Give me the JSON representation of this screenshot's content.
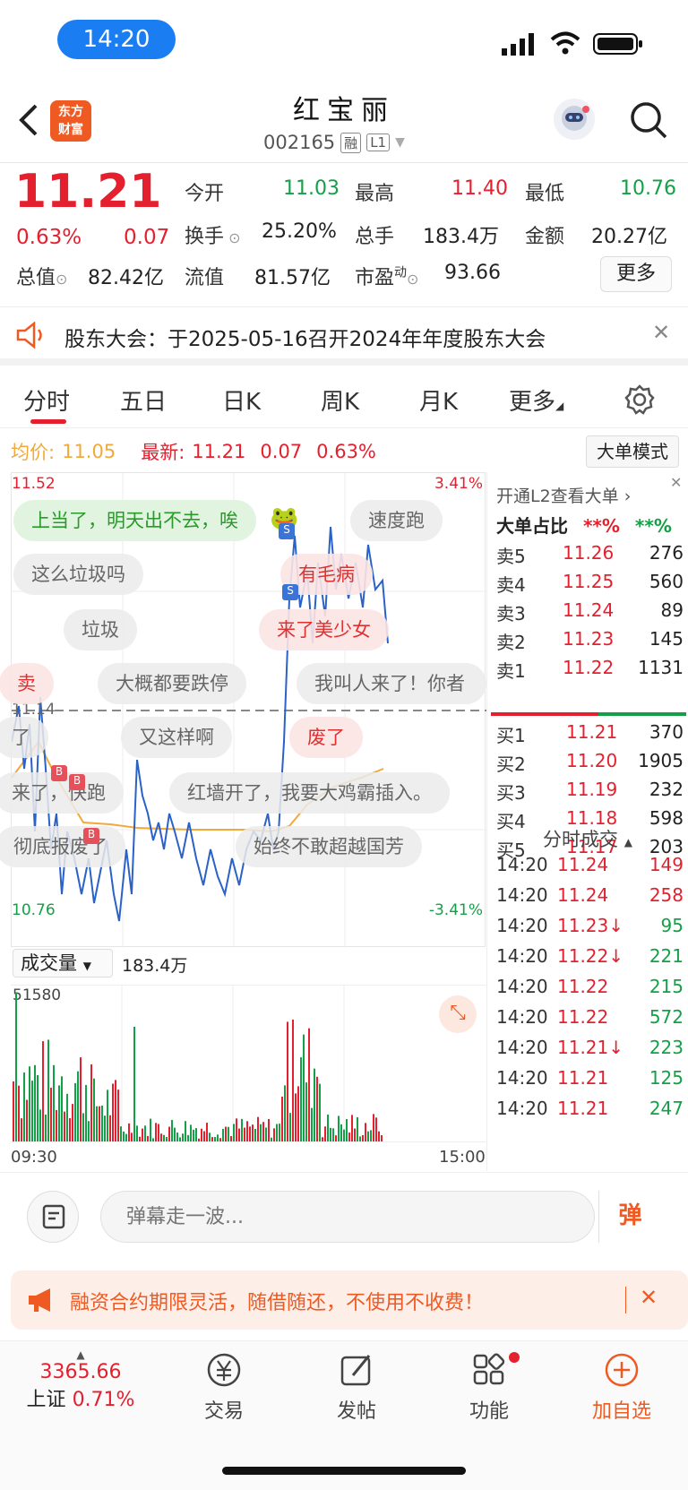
{
  "status": {
    "time": "14:20"
  },
  "header": {
    "title": "红宝丽",
    "code": "002165",
    "badge_rong": "融",
    "badge_l1": "L1",
    "logo_line1": "东方",
    "logo_line2": "财富"
  },
  "quote": {
    "price": "11.21",
    "pct": "0.63%",
    "chg": "0.07",
    "open_label": "今开",
    "open": "11.03",
    "high_label": "最高",
    "high": "11.40",
    "low_label": "最低",
    "low": "10.76",
    "turnover_label": "换手",
    "turnover": "25.20%",
    "volume_label": "总手",
    "volume": "183.4万",
    "amount_label": "金额",
    "amount": "20.27亿",
    "mktcap_label": "总值",
    "mktcap": "82.42亿",
    "float_label": "流值",
    "float": "81.57亿",
    "pe_label": "市盈",
    "pe_sup": "动",
    "pe": "93.66",
    "more": "更多"
  },
  "notice": {
    "text": "股东大会：于2025-05-16召开2024年年度股东大会"
  },
  "tabs": [
    "分时",
    "五日",
    "日K",
    "周K",
    "月K",
    "更多"
  ],
  "chart_info": {
    "avg_label": "均价:",
    "avg": "11.05",
    "latest_label": "最新:",
    "latest": "11.21",
    "chg": "0.07",
    "pct": "0.63%",
    "mode_button": "大单模式",
    "y_top": "11.52",
    "y_bottom": "10.76",
    "pct_top": "3.41%",
    "pct_bottom": "-3.41%",
    "mid_label": "11.14"
  },
  "danmaku": [
    {
      "text": "上当了，明天出不去，唉",
      "style": "green"
    },
    {
      "text": "速度跑",
      "style": "gray"
    },
    {
      "text": "这么垃圾吗",
      "style": "gray"
    },
    {
      "text": "有毛病",
      "style": "pink"
    },
    {
      "text": "垃圾",
      "style": "gray"
    },
    {
      "text": "来了美少女",
      "style": "pink"
    },
    {
      "text": "卖",
      "style": "pink"
    },
    {
      "text": "大概都要跌停",
      "style": "gray"
    },
    {
      "text": "我叫人来了！你者",
      "style": "gray"
    },
    {
      "text": "了",
      "style": "gray"
    },
    {
      "text": "又这样啊",
      "style": "gray"
    },
    {
      "text": "废了",
      "style": "pink"
    },
    {
      "text": "来了，快跑",
      "style": "gray"
    },
    {
      "text": "红墙开了，我要大鸡霸插入。",
      "style": "gray"
    },
    {
      "text": "彻底报废了",
      "style": "gray"
    },
    {
      "text": "始终不敢超越国芳",
      "style": "gray"
    }
  ],
  "orderbook": {
    "l2_text": "开通L2查看大单",
    "big_ratio_label": "大单占比",
    "ratio_sell": "**%",
    "ratio_buy": "**%",
    "asks": [
      {
        "label": "卖5",
        "price": "11.26",
        "vol": "276"
      },
      {
        "label": "卖4",
        "price": "11.25",
        "vol": "560"
      },
      {
        "label": "卖3",
        "price": "11.24",
        "vol": "89"
      },
      {
        "label": "卖2",
        "price": "11.23",
        "vol": "145"
      },
      {
        "label": "卖1",
        "price": "11.22",
        "vol": "1131"
      }
    ],
    "bids": [
      {
        "label": "买1",
        "price": "11.21",
        "vol": "370"
      },
      {
        "label": "买2",
        "price": "11.20",
        "vol": "1905"
      },
      {
        "label": "买3",
        "price": "11.19",
        "vol": "232"
      },
      {
        "label": "买4",
        "price": "11.18",
        "vol": "598"
      },
      {
        "label": "买5",
        "price": "11.17",
        "vol": "203"
      }
    ],
    "trades_title": "分时成交",
    "trades": [
      {
        "t": "14:20",
        "p": "11.24",
        "v": "149",
        "dir": "up"
      },
      {
        "t": "14:20",
        "p": "11.24",
        "v": "258",
        "dir": "up"
      },
      {
        "t": "14:20",
        "p": "11.23↓",
        "v": "95",
        "dir": "down"
      },
      {
        "t": "14:20",
        "p": "11.22↓",
        "v": "221",
        "dir": "down"
      },
      {
        "t": "14:20",
        "p": "11.22",
        "v": "215",
        "dir": "down"
      },
      {
        "t": "14:20",
        "p": "11.22",
        "v": "572",
        "dir": "down"
      },
      {
        "t": "14:20",
        "p": "11.21↓",
        "v": "223",
        "dir": "down"
      },
      {
        "t": "14:20",
        "p": "11.21",
        "v": "125",
        "dir": "down"
      },
      {
        "t": "14:20",
        "p": "11.21",
        "v": "247",
        "dir": "down"
      }
    ]
  },
  "volume_panel": {
    "selector": "成交量",
    "total": "183.4万",
    "max": "51580",
    "start": "09:30",
    "end": "15:00"
  },
  "input": {
    "placeholder": "弹幕走一波...",
    "send": "弹"
  },
  "promo": {
    "text": "融资合约期限灵活，随借随还，不使用不收费！"
  },
  "bottom": {
    "index_value": "3365.66",
    "index_name": "上证",
    "index_pct": "0.71%",
    "trade": "交易",
    "post": "发帖",
    "func": "功能",
    "add": "加自选"
  },
  "colors": {
    "up": "#e5202e",
    "down": "#14a046",
    "avg_line": "#f2a93b",
    "price_line": "#2a62c8"
  }
}
